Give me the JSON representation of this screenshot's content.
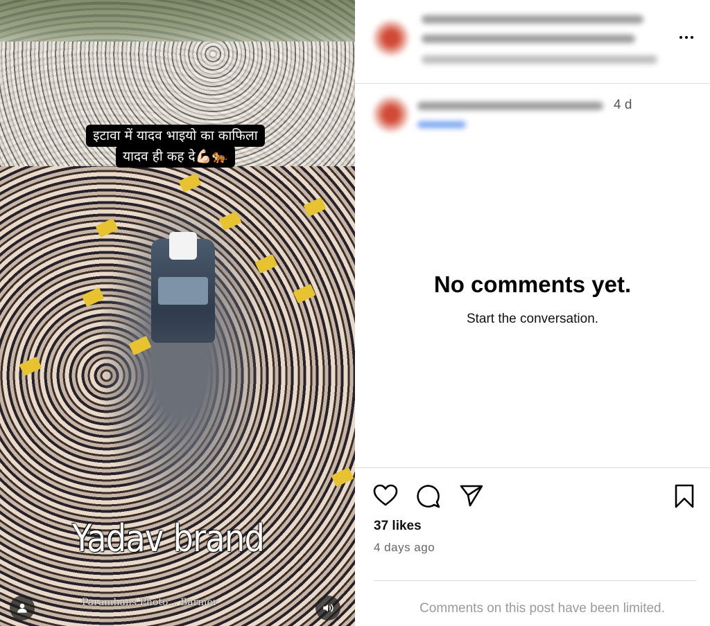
{
  "post": {
    "caption_line1": "इटावा में यादव भाइयो का काफिला",
    "caption_line2": "यादव ही कह दे💪🏻🐅",
    "overlay_text": "Yadav brand",
    "watermark": "Paramhans Photo... Barmer"
  },
  "header": {
    "author_names": "anurag_yadav_anurag_08 and pradeep_yadav",
    "author_sub": "Shubham Yadav Saharanpur, Kalu Yad..."
  },
  "comment_header": {
    "username": "anurag_yadav_anurag_08",
    "time_ago": "4 d",
    "link": "Reply"
  },
  "comments": {
    "empty_title": "No comments yet.",
    "empty_subtitle": "Start the conversation.",
    "limited_notice": "Comments on this post have been limited."
  },
  "stats": {
    "likes": "37 likes",
    "posted_ago": "4 days ago"
  },
  "icons": {
    "like": "heart-icon",
    "comment": "comment-icon",
    "share": "paper-plane-icon",
    "save": "bookmark-icon",
    "more": "more-horizontal-icon",
    "tag": "user-tag-icon",
    "audio": "speaker-icon"
  },
  "colors": {
    "accent": "#0095f6",
    "muted": "#737373",
    "divider": "#dbdbdb"
  }
}
